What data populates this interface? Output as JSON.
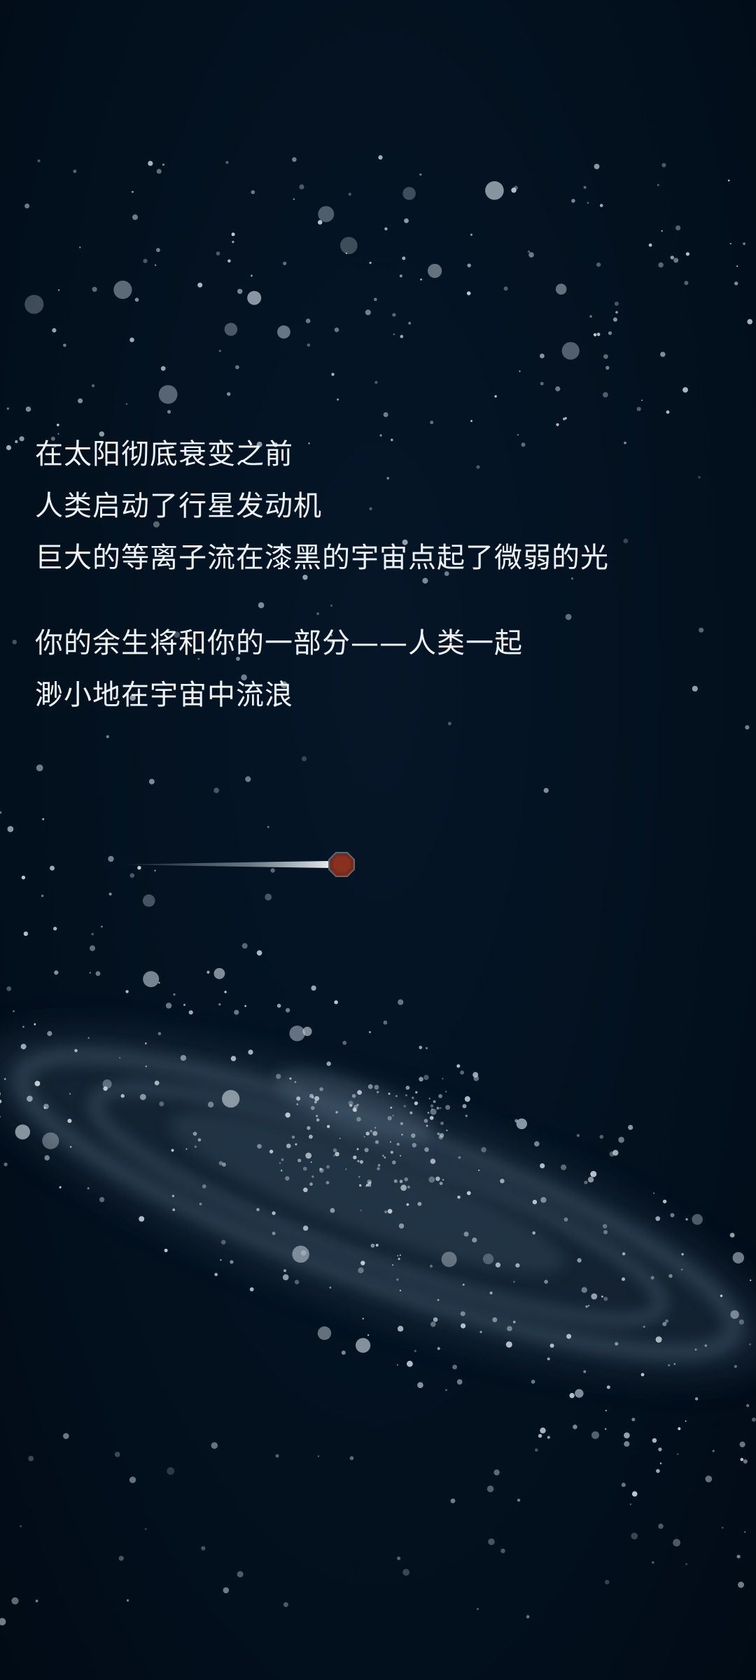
{
  "story": {
    "lines_group_1": [
      "在太阳彻底衰变之前",
      "人类启动了行星发动机",
      "巨大的等离子流在漆黑的宇宙点起了微弱的光"
    ],
    "lines_group_2": [
      "你的余生将和你的一部分——人类一起",
      "渺小地在宇宙中流浪"
    ]
  },
  "colors": {
    "background": "#02101e",
    "text": "#eef3f8",
    "star": "#c9d4de",
    "planet": "#7a2a1c",
    "galaxy_band": "#2b3f52"
  },
  "icons": {
    "planet": "red-planet-icon",
    "trail": "engine-trail-icon"
  }
}
